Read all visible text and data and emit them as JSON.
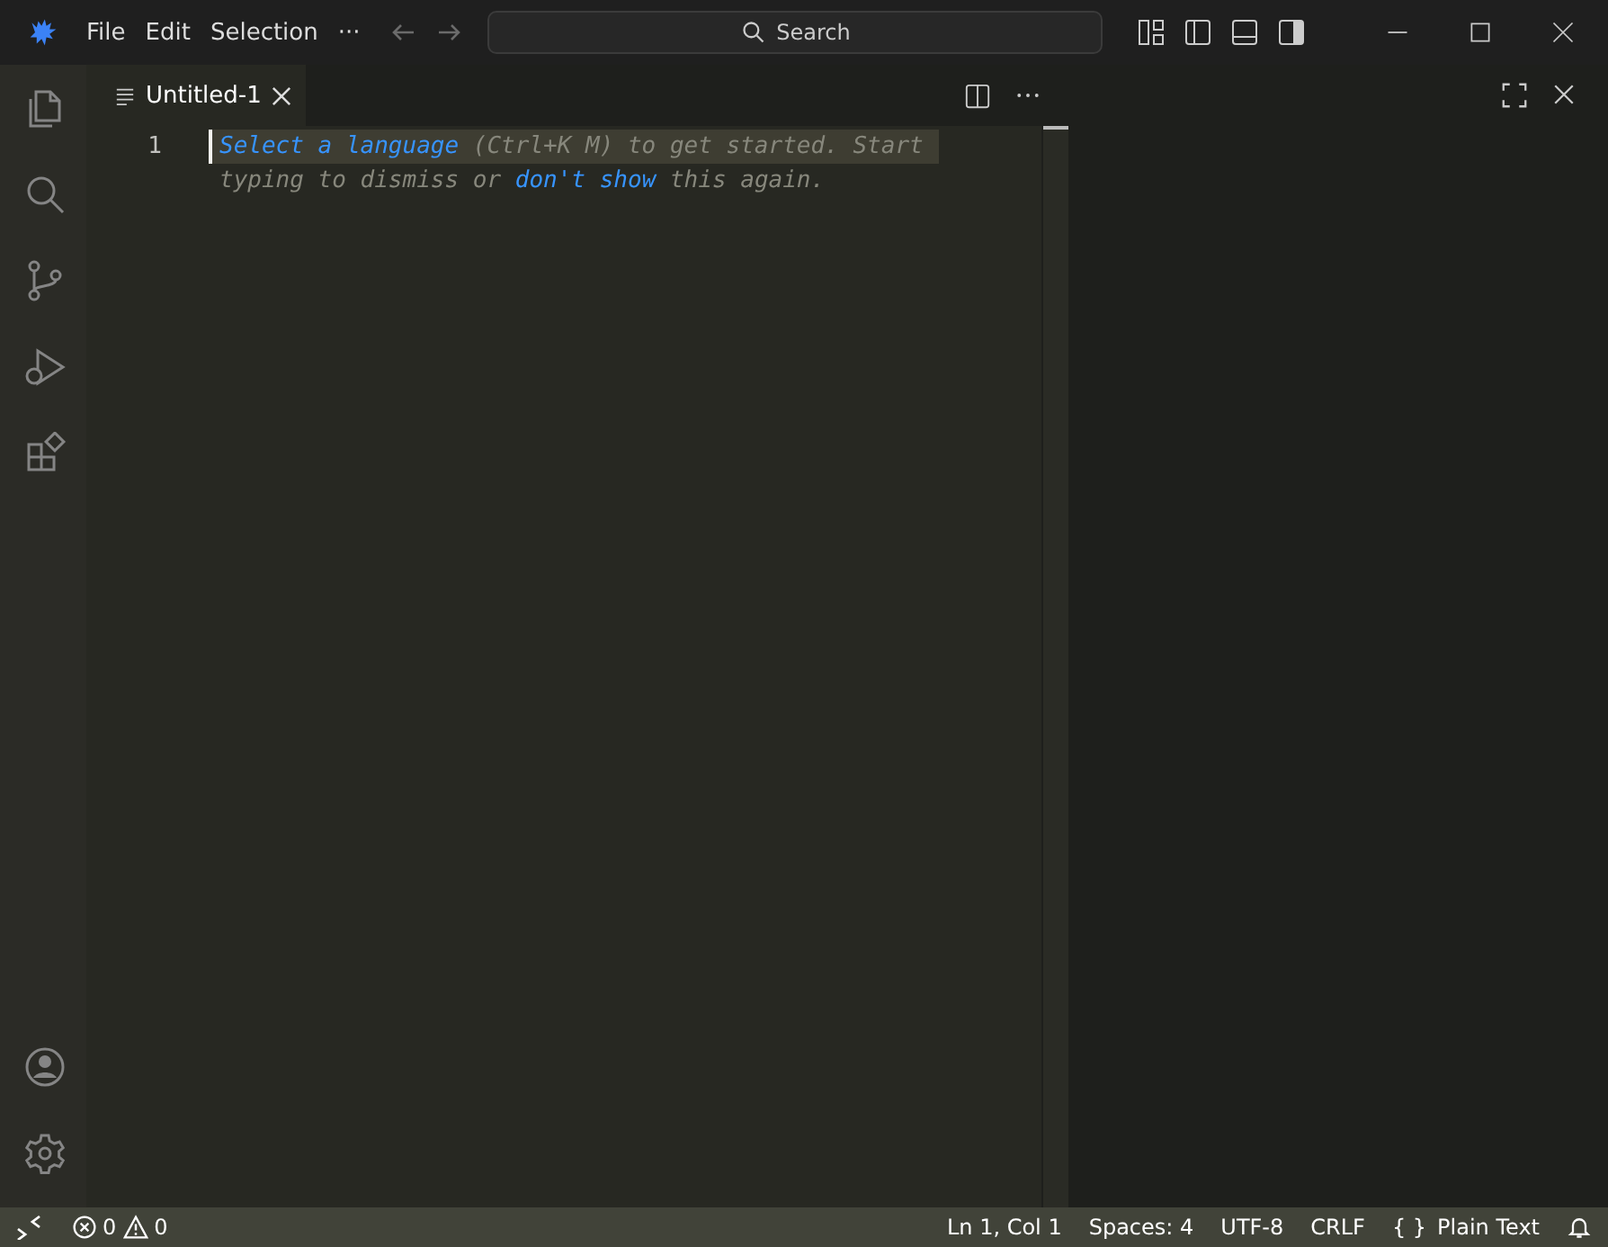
{
  "menu": [
    "File",
    "Edit",
    "Selection",
    "···"
  ],
  "search": {
    "placeholder": "Search"
  },
  "activity_bar": [
    {
      "kind": "files",
      "selected": false
    },
    {
      "kind": "search",
      "selected": false
    },
    {
      "kind": "scm",
      "selected": false
    },
    {
      "kind": "debug",
      "selected": false
    },
    {
      "kind": "extensions",
      "selected": false
    }
  ],
  "activity_bottom": [
    {
      "kind": "account"
    },
    {
      "kind": "settings"
    }
  ],
  "tabs": [
    {
      "label": "Untitled-1",
      "selected": true
    }
  ],
  "editor": {
    "line_numbers": [
      "1"
    ],
    "hint_lines": [
      [
        {
          "kind": "link",
          "text": "Select a language"
        },
        {
          "kind": "text",
          "text": " (Ctrl+K M) to get started. Start"
        }
      ],
      [
        {
          "kind": "text",
          "text": "typing to dismiss or "
        },
        {
          "kind": "link",
          "text": "don't show"
        },
        {
          "kind": "text",
          "text": " this again."
        }
      ]
    ]
  },
  "status_bar": {
    "errors": "0",
    "warnings": "0",
    "items": [
      {
        "kind": "text",
        "text": "Ln 1, Col 1"
      },
      {
        "kind": "text",
        "text": "Spaces: 4"
      },
      {
        "kind": "text",
        "text": "UTF-8"
      },
      {
        "kind": "text",
        "text": "CRLF"
      },
      {
        "kind": "language",
        "icon": "{ }",
        "text": "Plain Text"
      }
    ]
  }
}
